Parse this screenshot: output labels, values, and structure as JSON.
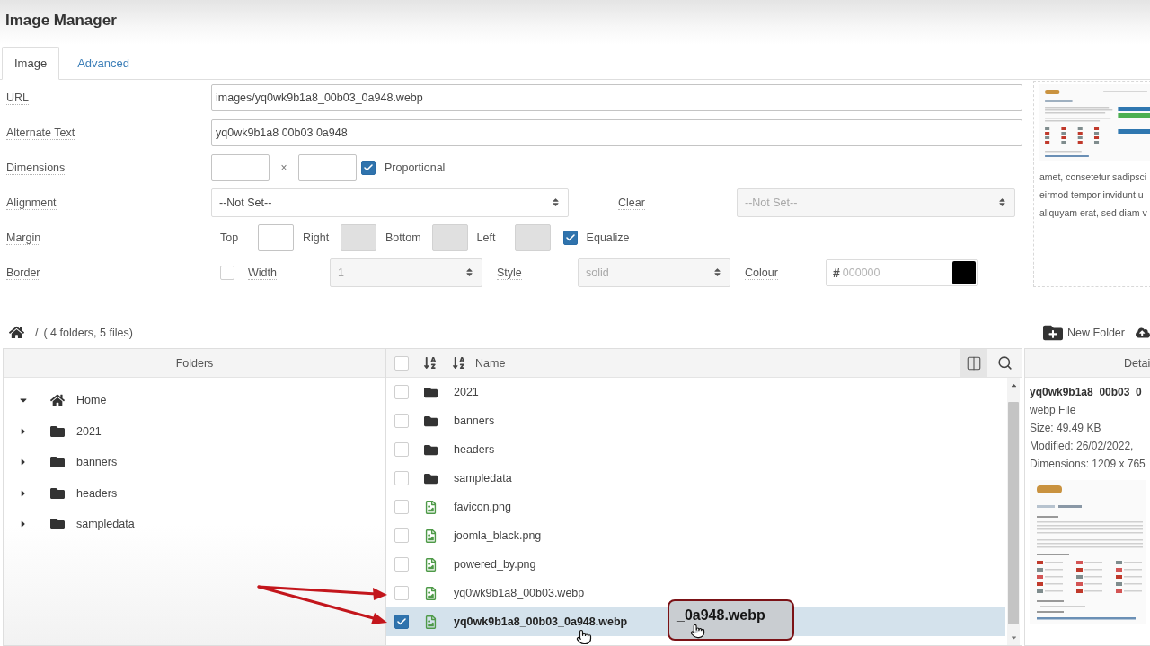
{
  "dialog": {
    "title": "Image Manager"
  },
  "tabs": [
    {
      "label": "Image",
      "selected": true
    },
    {
      "label": "Advanced",
      "selected": false
    }
  ],
  "form": {
    "url": {
      "label": "URL",
      "value": "images/yq0wk9b1a8_00b03_0a948.webp"
    },
    "alternate_text": {
      "label": "Alternate Text",
      "value": "yq0wk9b1a8 00b03 0a948"
    },
    "dimensions": {
      "label": "Dimensions",
      "separator": "×",
      "proportional": {
        "label": "Proportional",
        "checked": true
      }
    },
    "alignment": {
      "label": "Alignment",
      "value": "--Not Set--",
      "clear": {
        "label": "Clear",
        "value": "--Not Set--",
        "disabled": true
      }
    },
    "margin": {
      "label": "Margin",
      "fields": [
        {
          "label": "Top",
          "disabled": false
        },
        {
          "label": "Right",
          "disabled": true
        },
        {
          "label": "Bottom",
          "disabled": true
        },
        {
          "label": "Left",
          "disabled": true
        }
      ],
      "equalize": {
        "label": "Equalize",
        "checked": true
      }
    },
    "border": {
      "label": "Border",
      "checked": false,
      "width": {
        "label": "Width",
        "value": "1",
        "disabled": true
      },
      "style": {
        "label": "Style",
        "value": "solid",
        "disabled": true
      },
      "colour": {
        "label": "Colour",
        "prefix": "#",
        "placeholder": "000000"
      }
    }
  },
  "preview": {
    "text_lines": [
      "amet, consetetur sadipsci",
      "eirmod tempor invidunt u",
      "aliquyam erat, sed diam v"
    ]
  },
  "browser": {
    "breadcrumb": {
      "separator": "/",
      "summary": "( 4 folders, 5 files)"
    },
    "toolbar": [
      {
        "kind": "new-folder",
        "label": "New Folder"
      },
      {
        "kind": "upload"
      }
    ],
    "folders_panel": {
      "title": "Folders",
      "tree": [
        {
          "label": "Home",
          "kind": "home",
          "expanded": true,
          "children": [
            {
              "label": "2021",
              "kind": "folder",
              "expanded": false
            },
            {
              "label": "banners",
              "kind": "folder",
              "expanded": false
            },
            {
              "label": "headers",
              "kind": "folder",
              "expanded": false
            },
            {
              "label": "sampledata",
              "kind": "folder",
              "expanded": false
            }
          ]
        }
      ]
    },
    "files_panel": {
      "column": "Name",
      "select_all": {
        "checked": false
      },
      "files": [
        {
          "name": "2021",
          "kind": "folder",
          "selected": false
        },
        {
          "name": "banners",
          "kind": "folder",
          "selected": false
        },
        {
          "name": "headers",
          "kind": "folder",
          "selected": false
        },
        {
          "name": "sampledata",
          "kind": "folder",
          "selected": false
        },
        {
          "name": "favicon.png",
          "kind": "image",
          "selected": false
        },
        {
          "name": "joomla_black.png",
          "kind": "image",
          "selected": false
        },
        {
          "name": "powered_by.png",
          "kind": "image",
          "selected": false
        },
        {
          "name": "yq0wk9b1a8_00b03.webp",
          "kind": "image",
          "selected": false
        },
        {
          "name": "yq0wk9b1a8_00b03_0a948.webp",
          "kind": "image",
          "selected": true
        }
      ]
    },
    "details_panel": {
      "title": "Detai",
      "name": "yq0wk9b1a8_00b03_0",
      "type": "webp File",
      "size": "Size: 49.49 KB",
      "modified": "Modified: 26/02/2022,",
      "dimensions": "Dimensions: 1209 x 765"
    }
  },
  "drag_ghost": {
    "label": "_0a948.webp"
  }
}
